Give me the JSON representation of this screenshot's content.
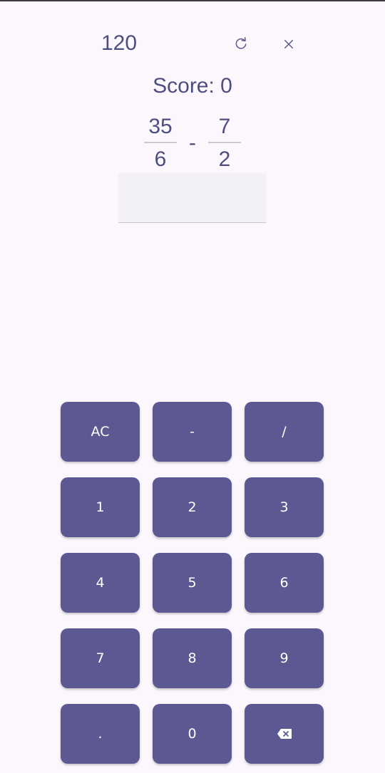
{
  "header": {
    "timer": "120",
    "restart_icon": "restart-icon",
    "close_icon": "close-icon"
  },
  "score_text": "Score: 0",
  "problem": {
    "left": {
      "numerator": "35",
      "denominator": "6"
    },
    "operator": "-",
    "right": {
      "numerator": "7",
      "denominator": "2"
    }
  },
  "answer": {
    "value": "",
    "placeholder": ""
  },
  "keypad": {
    "keys": [
      {
        "label": "AC",
        "name": "clear-key"
      },
      {
        "label": "-",
        "name": "minus-key"
      },
      {
        "label": "/",
        "name": "slash-key"
      },
      {
        "label": "1",
        "name": "digit-1-key"
      },
      {
        "label": "2",
        "name": "digit-2-key"
      },
      {
        "label": "3",
        "name": "digit-3-key"
      },
      {
        "label": "4",
        "name": "digit-4-key"
      },
      {
        "label": "5",
        "name": "digit-5-key"
      },
      {
        "label": "6",
        "name": "digit-6-key"
      },
      {
        "label": "7",
        "name": "digit-7-key"
      },
      {
        "label": "8",
        "name": "digit-8-key"
      },
      {
        "label": "9",
        "name": "digit-9-key"
      },
      {
        "label": ".",
        "name": "decimal-key"
      },
      {
        "label": "0",
        "name": "digit-0-key"
      },
      {
        "label": "",
        "name": "backspace-key",
        "icon": "backspace-icon"
      }
    ]
  },
  "colors": {
    "background": "#fbf7fd",
    "text": "#4f4e80",
    "key": "#5c5992",
    "key_text": "#ffffff"
  }
}
